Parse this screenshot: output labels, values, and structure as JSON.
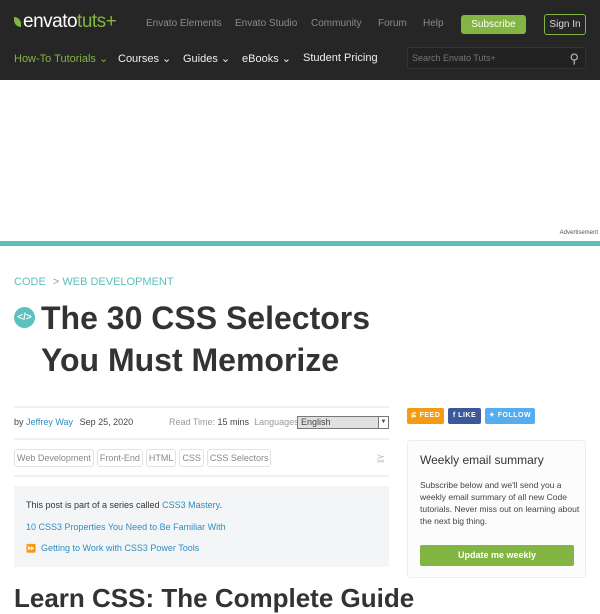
{
  "header": {
    "logo": "envatotuts+",
    "logo_main": "envato",
    "logo_accent": "tuts+",
    "top_links": [
      "Envato Elements",
      "Envato Studio",
      "Community",
      "Forum",
      "Help"
    ],
    "subscribe": "Subscribe",
    "sign_in": "Sign In",
    "nav": [
      "How-To Tutorials ⌄",
      "Courses ⌄",
      "Guides ⌄",
      "eBooks ⌄",
      "Student Pricing"
    ],
    "search_placeholder": "Search Envato Tuts+"
  },
  "advertisement": "Advertisement",
  "article": {
    "breadcrumb": [
      "CODE",
      ">",
      "WEB DEVELOPMENT"
    ],
    "title": "The 30 CSS Selectors You Must Memorize",
    "by": "by",
    "author": "Jeffrey Way",
    "date": "Sep 25, 2020",
    "read_time_label": "Read Time:",
    "read_time": "15 mins",
    "languages_label": "Languages:",
    "language": "English",
    "tags": [
      "Web Development",
      "Front-End",
      "HTML",
      "CSS",
      "CSS Selectors"
    ],
    "series": {
      "intro": "This post is part of a series called",
      "series_name": "CSS3 Mastery",
      "period": ".",
      "items": [
        "10 CSS3 Properties You Need to Be Familiar With",
        "Getting to Work with CSS3 Power Tools"
      ]
    },
    "heading": "Learn CSS: The Complete Guide"
  },
  "sidebar": {
    "feed": "FEED",
    "like": "LIKE",
    "follow": "FOLLOW",
    "newsletter_title": "Weekly email summary",
    "newsletter_text": "Subscribe below and we'll send you a weekly email summary of all new Code tutorials. Never miss out on learning about the next big thing.",
    "newsletter_button": "Update me weekly"
  },
  "colors": {
    "brand": "#82b541",
    "accent": "#5bc1bc",
    "link": "#2d8fc2"
  }
}
